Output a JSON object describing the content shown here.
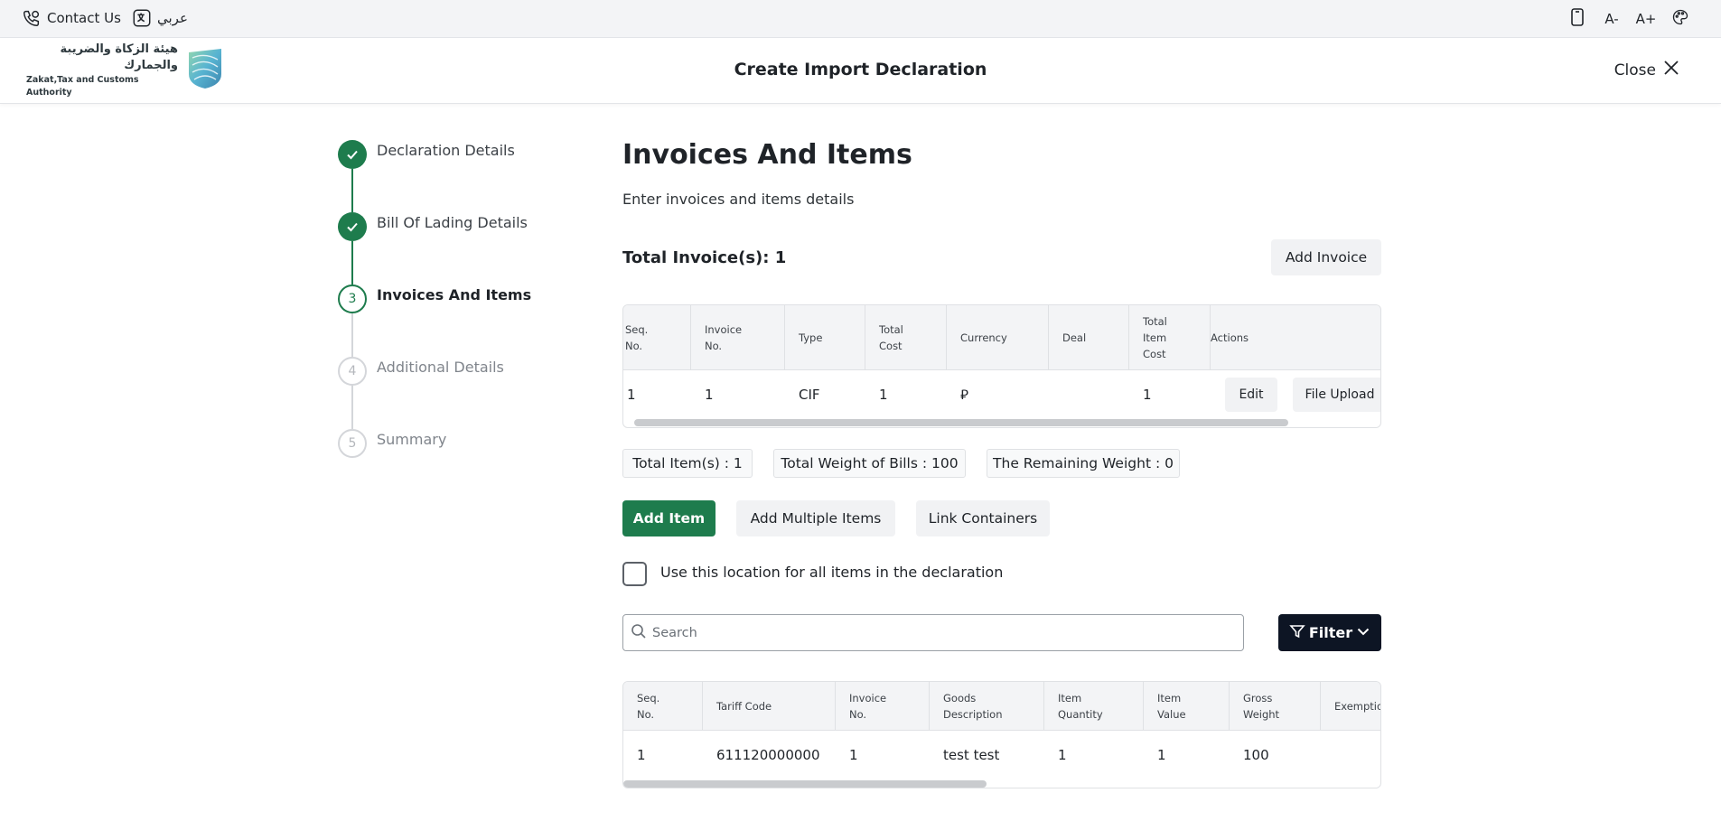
{
  "topbar": {
    "contact_label": "Contact Us",
    "language_label": "عربي",
    "icons": [
      "contact-phone-icon",
      "translate-icon",
      "mobile-icon",
      "font-decrease-icon",
      "font-increase-icon",
      "palette-icon"
    ],
    "font_decrease": "A-",
    "font_increase": "A+"
  },
  "header": {
    "logo_ar": "هيئة الزكاة والضريبة والجمارك",
    "logo_en": "Zakat,Tax and Customs Authority",
    "title": "Create Import Declaration",
    "close_label": "Close"
  },
  "steps": [
    {
      "label": "Declaration Details",
      "state": "done"
    },
    {
      "label": "Bill Of Lading Details",
      "state": "done"
    },
    {
      "number": "3",
      "label": "Invoices And Items",
      "state": "current"
    },
    {
      "number": "4",
      "label": "Additional Details",
      "state": "todo"
    },
    {
      "number": "5",
      "label": "Summary",
      "state": "todo"
    }
  ],
  "main": {
    "title": "Invoices And Items",
    "subtitle": "Enter invoices and items details",
    "total_invoices": "Total Invoice(s): 1",
    "add_invoice_label": "Add Invoice"
  },
  "invoices_table": {
    "headers": [
      "Seq.\nNo.",
      "Invoice\nNo.",
      "Type",
      "Total\nCost",
      "Currency",
      "Deal",
      "Total\nItem\nCost",
      "Actions"
    ],
    "rows": [
      {
        "seq": "1",
        "invoice_no": "1",
        "type": "CIF",
        "total_cost": "1",
        "currency": "⃁",
        "deal": "",
        "total_item_cost": "1",
        "edit_label": "Edit",
        "upload_label": "File Upload"
      }
    ]
  },
  "summary_badges": {
    "total_items": "Total Item(s) : 1",
    "total_weight": "Total Weight of Bills : 100",
    "remaining_weight": "The Remaining Weight : 0"
  },
  "item_actions": {
    "add_item": "Add Item",
    "add_multiple": "Add Multiple Items",
    "link_containers": "Link Containers"
  },
  "location_checkbox": {
    "label": "Use this location for all items in the declaration",
    "checked": false
  },
  "search": {
    "placeholder": "Search",
    "value": ""
  },
  "filter_label": "Filter",
  "items_table": {
    "headers": [
      "Seq.\nNo.",
      "Tariff Code",
      "Invoice\nNo.",
      "Goods\nDescription",
      "Item\nQuantity",
      "Item\nValue",
      "Gross\nWeight",
      "Exemptio"
    ],
    "rows": [
      {
        "seq": "1",
        "tariff_code": "611120000000",
        "invoice_no": "1",
        "goods_description": "test test",
        "item_quantity": "1",
        "item_value": "1",
        "gross_weight": "100",
        "exemption": ""
      }
    ]
  },
  "colors": {
    "primary_green": "#1e7c4d",
    "filter_dark": "#0d1524",
    "topbar_bg": "#f3f4f6"
  }
}
